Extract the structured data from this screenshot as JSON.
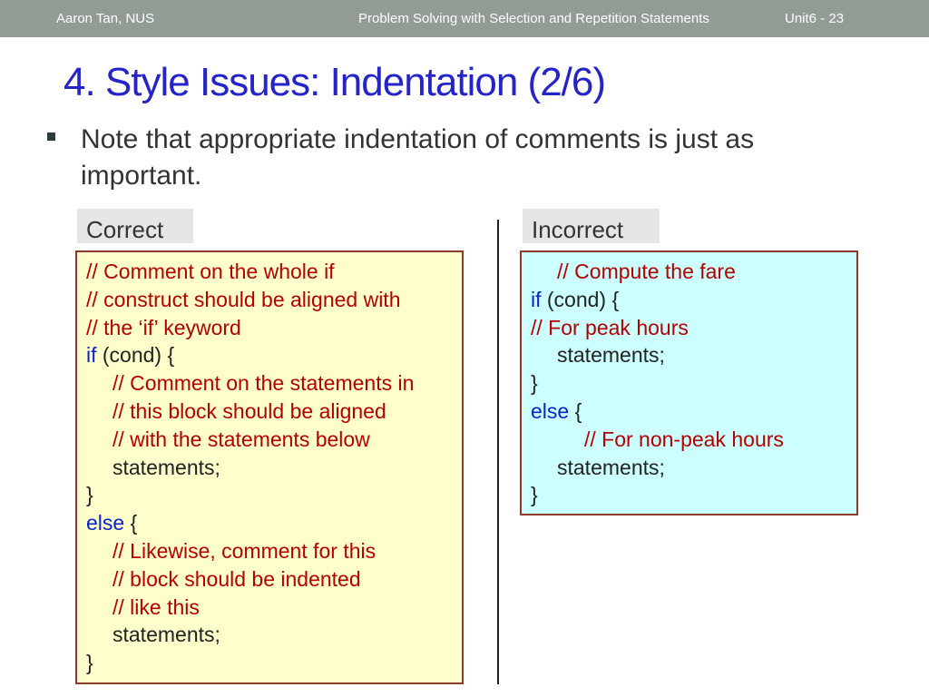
{
  "header": {
    "author": "Aaron Tan, NUS",
    "course": "Problem Solving with Selection and Repetition Statements",
    "page": "Unit6 - 23"
  },
  "title": "4. Style Issues: Indentation (2/6)",
  "bullet": "Note that appropriate indentation of comments is just as important.",
  "correct": {
    "label": "Correct",
    "lines": [
      {
        "indent": 0,
        "parts": [
          {
            "t": "c",
            "v": "// Comment on the whole if"
          }
        ]
      },
      {
        "indent": 0,
        "parts": [
          {
            "t": "c",
            "v": "// construct should be aligned with"
          }
        ]
      },
      {
        "indent": 0,
        "parts": [
          {
            "t": "c",
            "v": "// the ‘if’ keyword"
          }
        ]
      },
      {
        "indent": 0,
        "parts": [
          {
            "t": "k",
            "v": "if"
          },
          {
            "t": "n",
            "v": " (cond) {"
          }
        ]
      },
      {
        "indent": 1,
        "parts": [
          {
            "t": "c",
            "v": "// Comment on the statements in"
          }
        ]
      },
      {
        "indent": 1,
        "parts": [
          {
            "t": "c",
            "v": "// this block should be aligned"
          }
        ]
      },
      {
        "indent": 1,
        "parts": [
          {
            "t": "c",
            "v": "// with the statements below"
          }
        ]
      },
      {
        "indent": 1,
        "parts": [
          {
            "t": "n",
            "v": "statements;"
          }
        ]
      },
      {
        "indent": 0,
        "parts": [
          {
            "t": "n",
            "v": "}"
          }
        ]
      },
      {
        "indent": 0,
        "parts": [
          {
            "t": "k",
            "v": "else"
          },
          {
            "t": "n",
            "v": " {"
          }
        ]
      },
      {
        "indent": 1,
        "parts": [
          {
            "t": "c",
            "v": "// Likewise, comment for this"
          }
        ]
      },
      {
        "indent": 1,
        "parts": [
          {
            "t": "c",
            "v": "// block should be indented"
          }
        ]
      },
      {
        "indent": 1,
        "parts": [
          {
            "t": "c",
            "v": "// like this"
          }
        ]
      },
      {
        "indent": 1,
        "parts": [
          {
            "t": "n",
            "v": "statements;"
          }
        ]
      },
      {
        "indent": 0,
        "parts": [
          {
            "t": "n",
            "v": "}"
          }
        ]
      }
    ]
  },
  "incorrect": {
    "label": "Incorrect",
    "lines": [
      {
        "indent": 1,
        "parts": [
          {
            "t": "c",
            "v": "// Compute the fare"
          }
        ]
      },
      {
        "indent": 0,
        "parts": [
          {
            "t": "k",
            "v": "if"
          },
          {
            "t": "n",
            "v": " (cond) {"
          }
        ]
      },
      {
        "indent": 0,
        "parts": [
          {
            "t": "c",
            "v": "// For peak hours"
          }
        ]
      },
      {
        "indent": 1,
        "parts": [
          {
            "t": "n",
            "v": "statements;"
          }
        ]
      },
      {
        "indent": 0,
        "parts": [
          {
            "t": "n",
            "v": "}"
          }
        ]
      },
      {
        "indent": 0,
        "parts": [
          {
            "t": "k",
            "v": "else"
          },
          {
            "t": "n",
            "v": " {"
          }
        ]
      },
      {
        "indent": 2,
        "parts": [
          {
            "t": "c",
            "v": "// For non-peak hours"
          }
        ]
      },
      {
        "indent": 1,
        "parts": [
          {
            "t": "n",
            "v": "statements;"
          }
        ]
      },
      {
        "indent": 0,
        "parts": [
          {
            "t": "n",
            "v": "}"
          }
        ]
      }
    ]
  },
  "colors": {
    "comment": "#b30000",
    "keyword": "#0b24c9",
    "title": "#2424c8",
    "correct_bg": "#ffffcc",
    "incorrect_bg": "#ccffff"
  }
}
